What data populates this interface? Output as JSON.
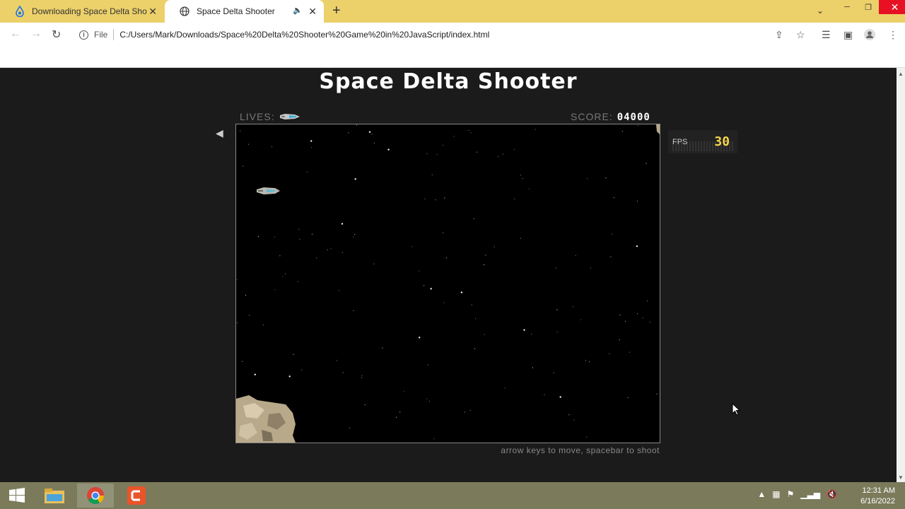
{
  "browser": {
    "tabs": [
      {
        "label": "Downloading Space Delta Shooter",
        "icon": "download-drop-icon"
      },
      {
        "label": "Space Delta Shooter",
        "icon": "globe-icon",
        "muted_icon": "speaker-icon"
      }
    ],
    "address": {
      "scheme_label": "File",
      "url": "C:/Users/Mark/Downloads/Space%20Delta%20Shooter%20Game%20in%20JavaScript/index.html"
    }
  },
  "game": {
    "title": "Space Delta Shooter",
    "lives_label": "LIVES:",
    "lives_count": 1,
    "score_label": "SCORE:",
    "score_value": "04000",
    "fps_label": "FPS",
    "fps_value": "30",
    "hint": "arrow keys to move, spacebar to shoot"
  },
  "taskbar": {
    "items": [
      "start-icon",
      "file-explorer-icon",
      "chrome-icon",
      "camtasia-icon"
    ],
    "time": "12:31 AM",
    "date": "6/16/2022"
  }
}
